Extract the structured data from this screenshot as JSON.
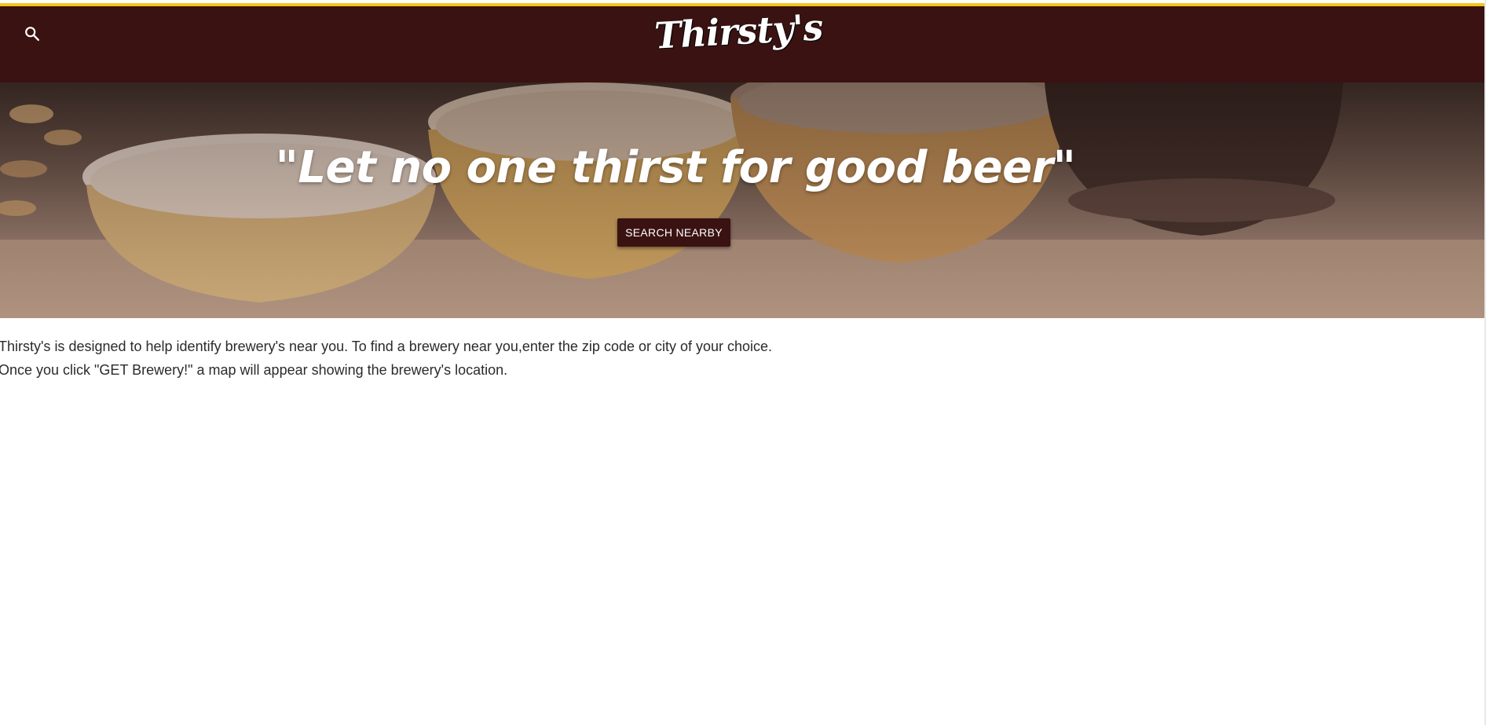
{
  "header": {
    "logo_text": "Thirsty's",
    "search_icon": "search-icon",
    "accent_color": "#f5c518",
    "bar_color": "#3a1212"
  },
  "hero": {
    "tagline": "\"Let no one thirst for good beer\"",
    "cta_label": "SEARCH NEARBY"
  },
  "description": {
    "line1": "Thirsty's is designed to help identify brewery's near you. To find a brewery near you,enter the zip code or city of your choice.",
    "line2": "Once you click \"GET Brewery!\" a map will appear showing the brewery's location."
  }
}
